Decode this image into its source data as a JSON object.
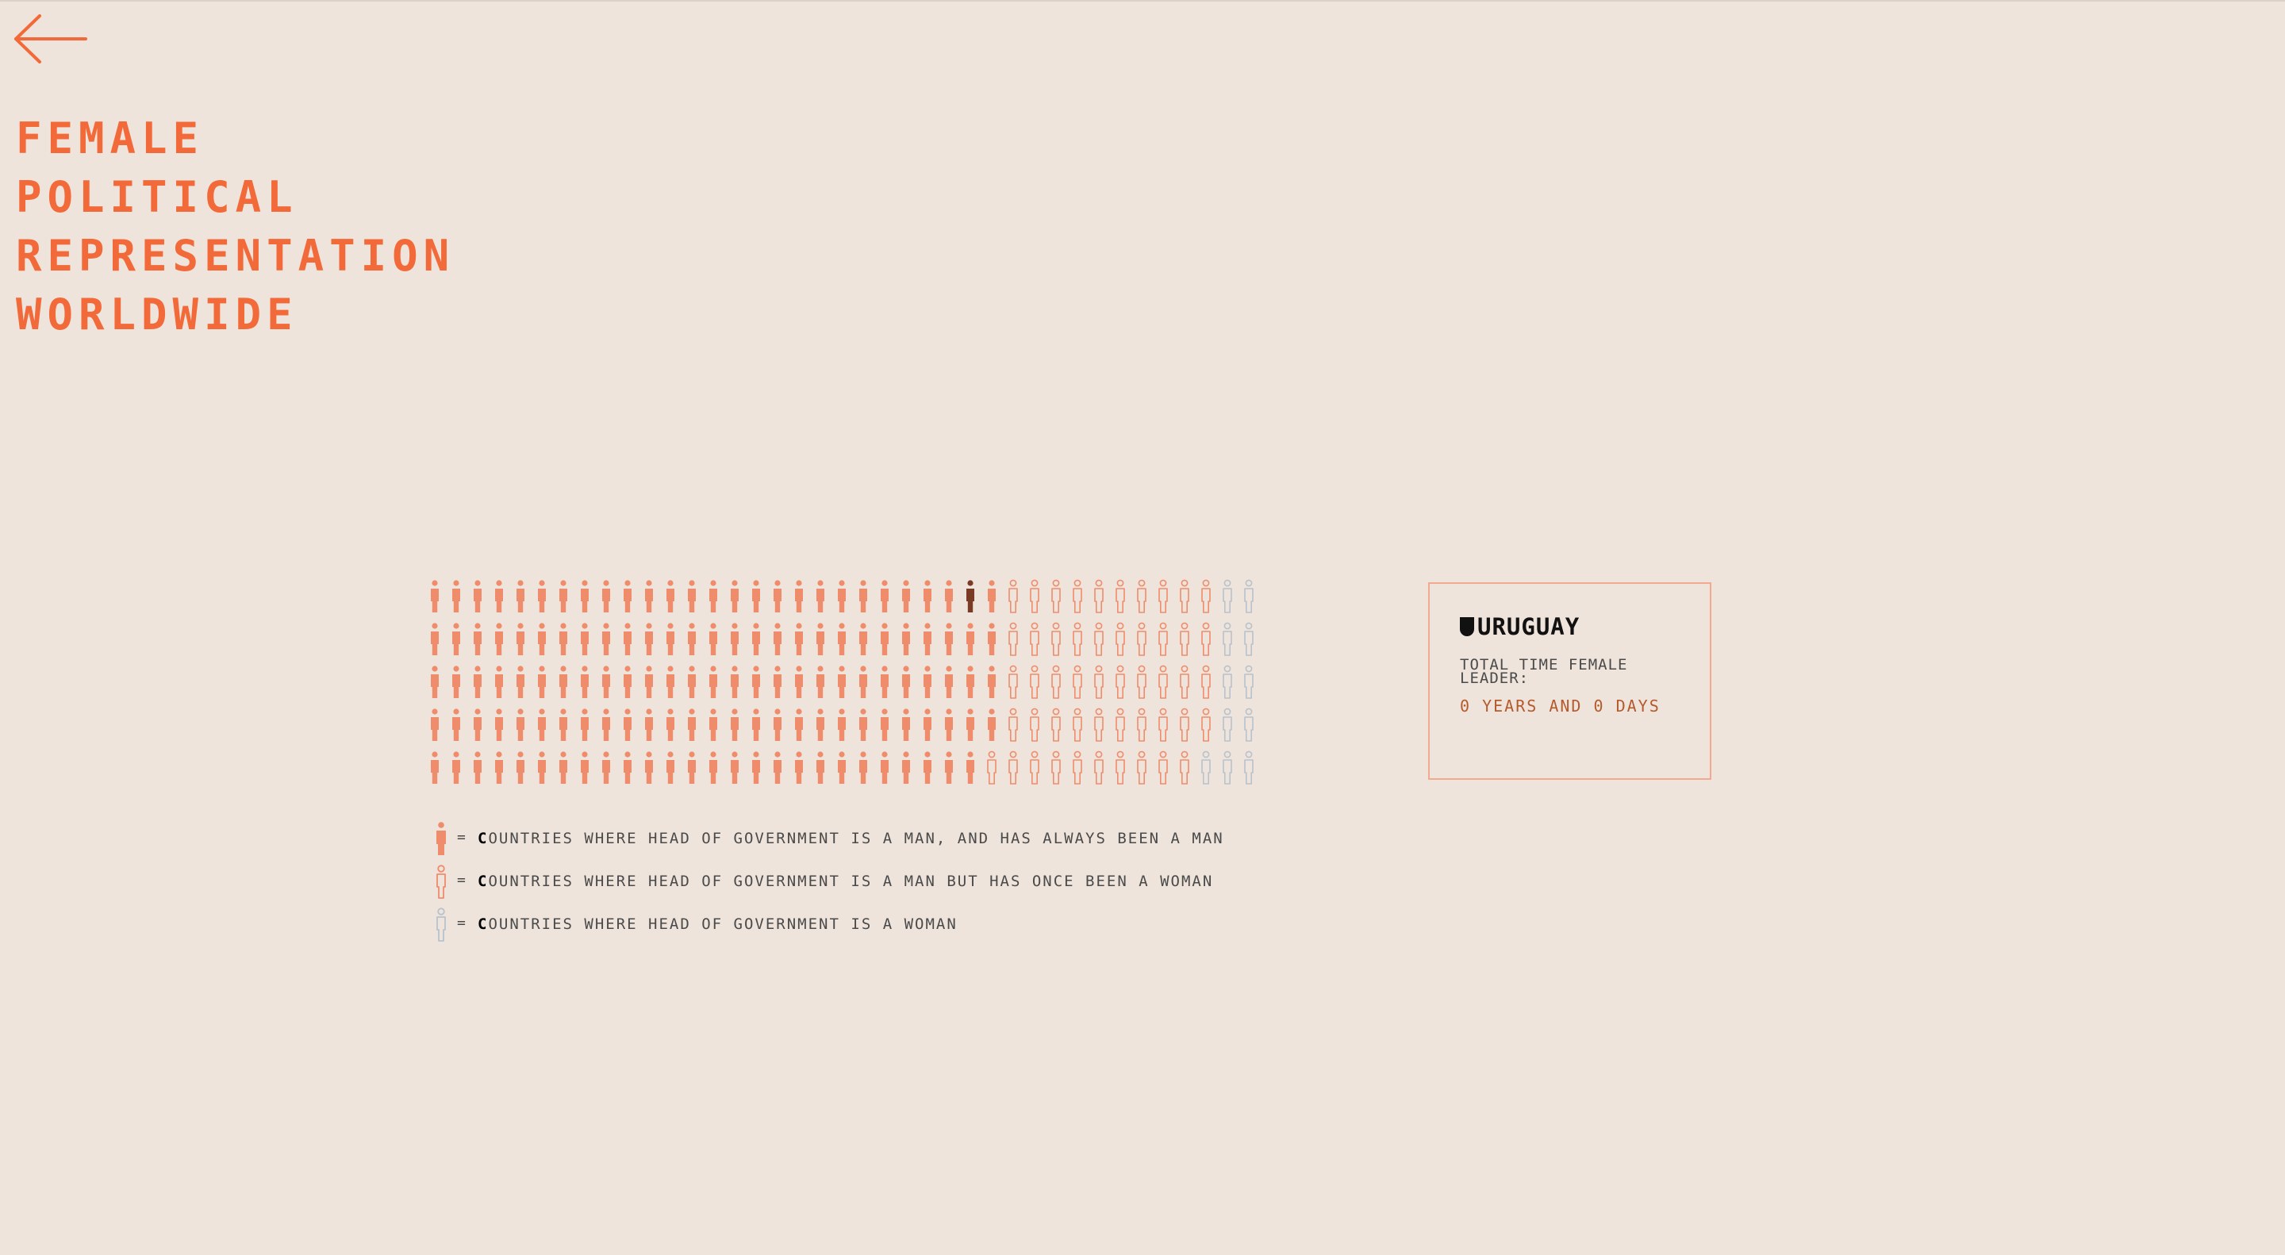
{
  "page": {
    "back_icon": "arrow-left-icon",
    "title_lines": [
      "Female",
      "Political",
      "Representation",
      "Worldwide"
    ],
    "accent_color": "#f26a3a"
  },
  "chart_data": {
    "type": "pictogram",
    "title": "Female Political Representation Worldwide",
    "rows": 5,
    "columns": 39,
    "total_icons": 195,
    "categories": [
      "always_man",
      "man_once_woman",
      "woman"
    ],
    "colors": {
      "always_man": "#ef8c6b",
      "man_once_woman": "#ef8c6b",
      "woman": "#b7c2cc",
      "highlight": "#7a3b24"
    },
    "grid": [
      "aaaaaaaaaaaaaaaaaaaaaaaaahaoooooooooowww",
      "aaaaaaaaaaaaaaaaaaaaaaaaaaaoooooooooowww",
      "aaaaaaaaaaaaaaaaaaaaaaaaaaaoooooooooowww",
      "aaaaaaaaaaaaaaaaaaaaaaaaaaaoooooooooowww",
      "aaaaaaaaaaaaaaaaaaaaaaaaaaoooooooooowwww"
    ],
    "highlighted": {
      "row": 1,
      "column": 26,
      "country": "Uruguay"
    },
    "legend": [
      {
        "key": "always_man",
        "style": "filled",
        "text": "Countries where head of government is a man, and has always been a man"
      },
      {
        "key": "man_once_woman",
        "style": "outline",
        "text": "Countries where head of government is a man but has once been a woman"
      },
      {
        "key": "woman",
        "style": "outline",
        "text": "Countries where head of government is a woman"
      }
    ]
  },
  "info_card": {
    "country": "Uruguay",
    "label": "Total time female leader:",
    "value": "0 years and 0 days"
  }
}
